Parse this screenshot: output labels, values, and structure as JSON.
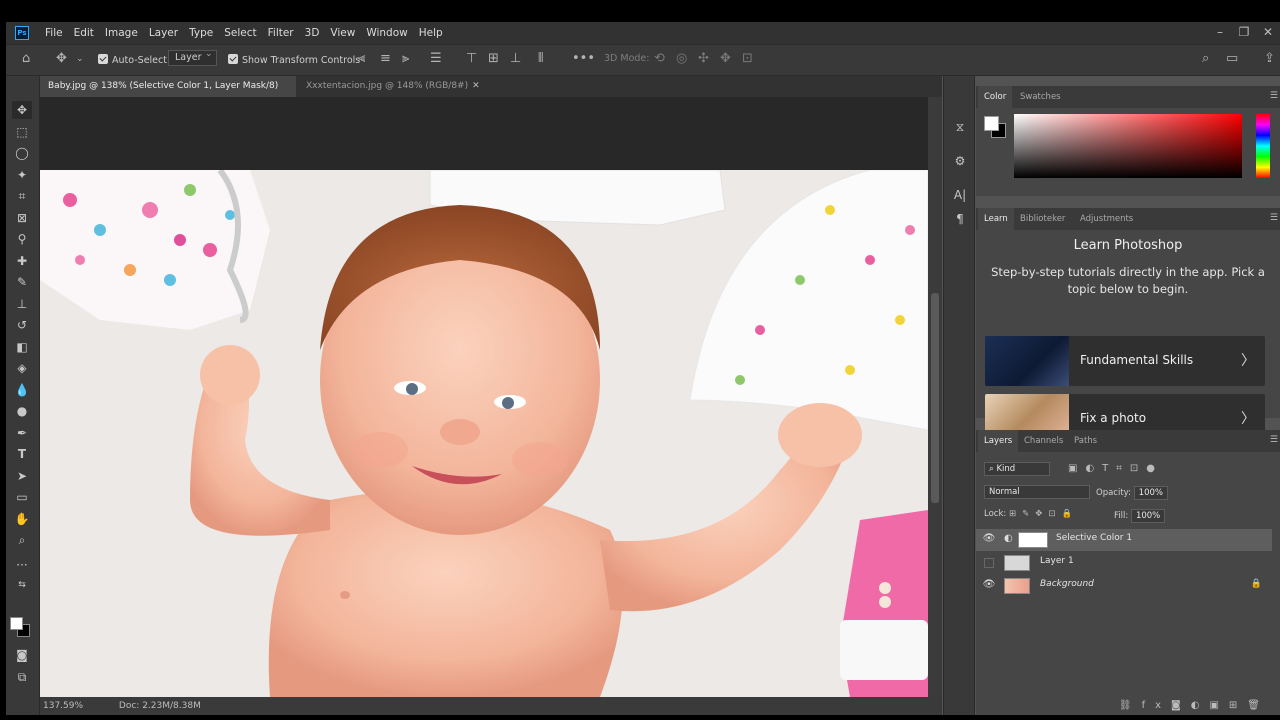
{
  "app": {
    "logo": "Ps"
  },
  "menu": [
    "File",
    "Edit",
    "Image",
    "Layer",
    "Type",
    "Select",
    "Filter",
    "3D",
    "View",
    "Window",
    "Help"
  ],
  "options_bar": {
    "auto_select_label": "Auto-Select:",
    "auto_select_target": "Layer",
    "show_transform_label": "Show Transform Controls",
    "three_d_mode_label": "3D Mode:"
  },
  "tabs": [
    {
      "title": "Baby.jpg @ 138% (Selective Color 1, Layer Mask/8) *"
    },
    {
      "title": "Xxxtentacion.jpg @ 148% (RGB/8#)"
    }
  ],
  "status": {
    "zoom": "137.59%",
    "doc": "Doc: 2.23M/8.38M"
  },
  "color_panel": {
    "tabs": [
      "Color",
      "Swatches"
    ],
    "active": "Color",
    "foreground": "#ffffff",
    "background": "#000000"
  },
  "learn_panel": {
    "tabs": [
      "Learn",
      "Biblioteker",
      "Adjustments"
    ],
    "title": "Learn Photoshop",
    "description": "Step-by-step tutorials directly in the app. Pick a topic below to begin.",
    "cards": [
      "Fundamental Skills",
      "Fix a photo"
    ]
  },
  "layers_panel": {
    "tabs": [
      "Layers",
      "Channels",
      "Paths"
    ],
    "filter_kind": "Kind",
    "blend_mode": "Normal",
    "opacity_label": "Opacity:",
    "opacity_value": "100%",
    "lock_label": "Lock:",
    "fill_label": "Fill:",
    "fill_value": "100%",
    "layers": [
      {
        "name": "Selective Color 1",
        "visible": true,
        "selected": true
      },
      {
        "name": "Layer 1",
        "visible": false,
        "selected": false
      },
      {
        "name": "Background",
        "visible": true,
        "selected": false,
        "locked": true
      }
    ]
  }
}
